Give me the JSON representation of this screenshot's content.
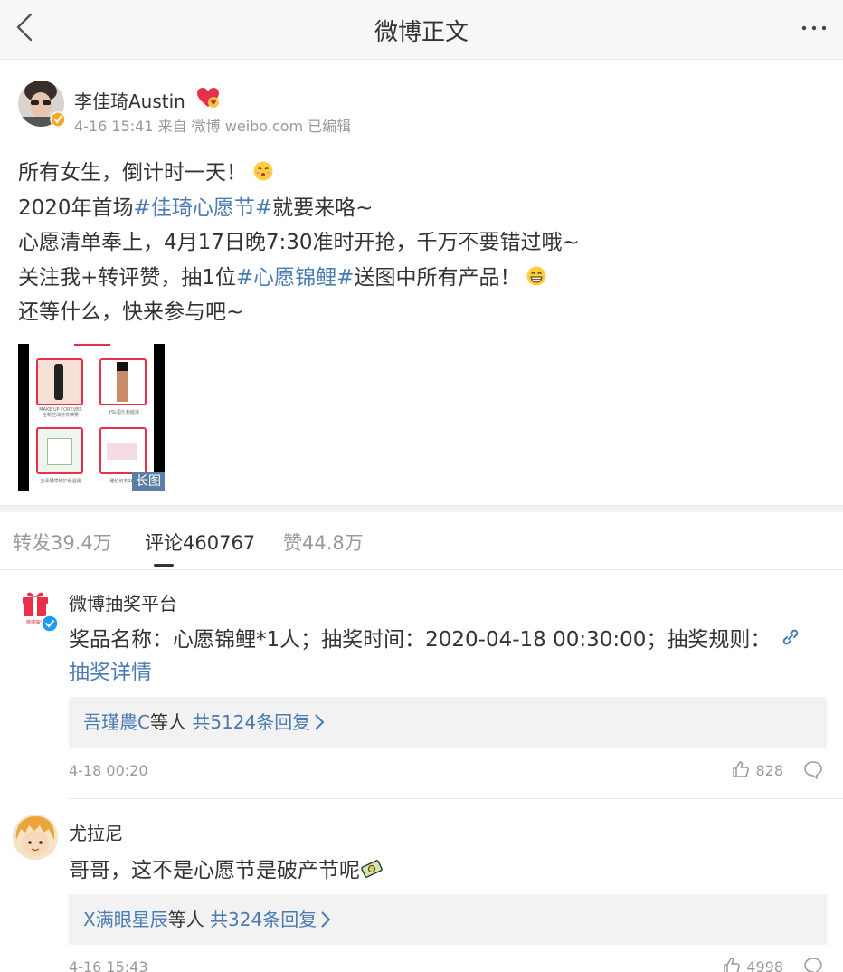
{
  "nav": {
    "title": "微博正文"
  },
  "post": {
    "author": "李佳琦Austin",
    "meta": "4-16 15:41 来自 微博 weibo.com 已编辑",
    "lines": [
      {
        "parts": [
          {
            "t": "所有女生，倒计时一天！",
            "tag": false
          }
        ],
        "emoji": "kiss-emoji"
      },
      {
        "parts": [
          {
            "t": "2020年首场",
            "tag": false
          },
          {
            "t": "#佳琦心愿节#",
            "tag": true
          },
          {
            "t": "就要来咯~",
            "tag": false
          }
        ]
      },
      {
        "parts": [
          {
            "t": "心愿清单奉上，4月17日晚7:30准时开抢，千万不要错过哦~",
            "tag": false
          }
        ]
      },
      {
        "parts": [
          {
            "t": "关注我+转评赞，抽1位",
            "tag": false
          },
          {
            "t": "#心愿锦鲤#",
            "tag": true
          },
          {
            "t": "送图中所有产品！",
            "tag": false
          }
        ],
        "emoji": "grin-emoji"
      },
      {
        "parts": [
          {
            "t": "还等什么，快来参与吧~",
            "tag": false
          }
        ]
      }
    ],
    "image_tag": "长图",
    "image_captions": [
      "MAKE UP FOREVER\n全新控油持妆喷雾",
      "YSL恒久粉底液",
      "玉泽屏障修护保湿霜",
      "雅伦纳美28天"
    ]
  },
  "tabs": {
    "repost": "转发39.4万",
    "comment": "评论460767",
    "like": "赞44.8万"
  },
  "comments": [
    {
      "name": "微博抽奖平台",
      "text": "奖品名称：心愿锦鲤*1人；抽奖时间：2020-04-18 00:30:00；抽奖规则：",
      "link_text": "抽奖详情",
      "reply_user": "吾瑾農C",
      "reply_mid": "等人 ",
      "reply_count": "共5124条回复",
      "date": "4-18 00:20",
      "likes": "828",
      "avatar_caption": "微博抽奖"
    },
    {
      "name": "尤拉尼",
      "text": "哥哥，这不是心愿节是破产节呢",
      "reply_user": "X满眼星辰",
      "reply_mid": "等人 ",
      "reply_count": "共324条回复",
      "date": "4-16 15:43",
      "likes": "4998"
    }
  ],
  "colors": {
    "link": "#4a7bb2",
    "accent_red": "#e8304b",
    "verified_blue": "#1d9bf0",
    "verified_orange": "#f5a623"
  }
}
